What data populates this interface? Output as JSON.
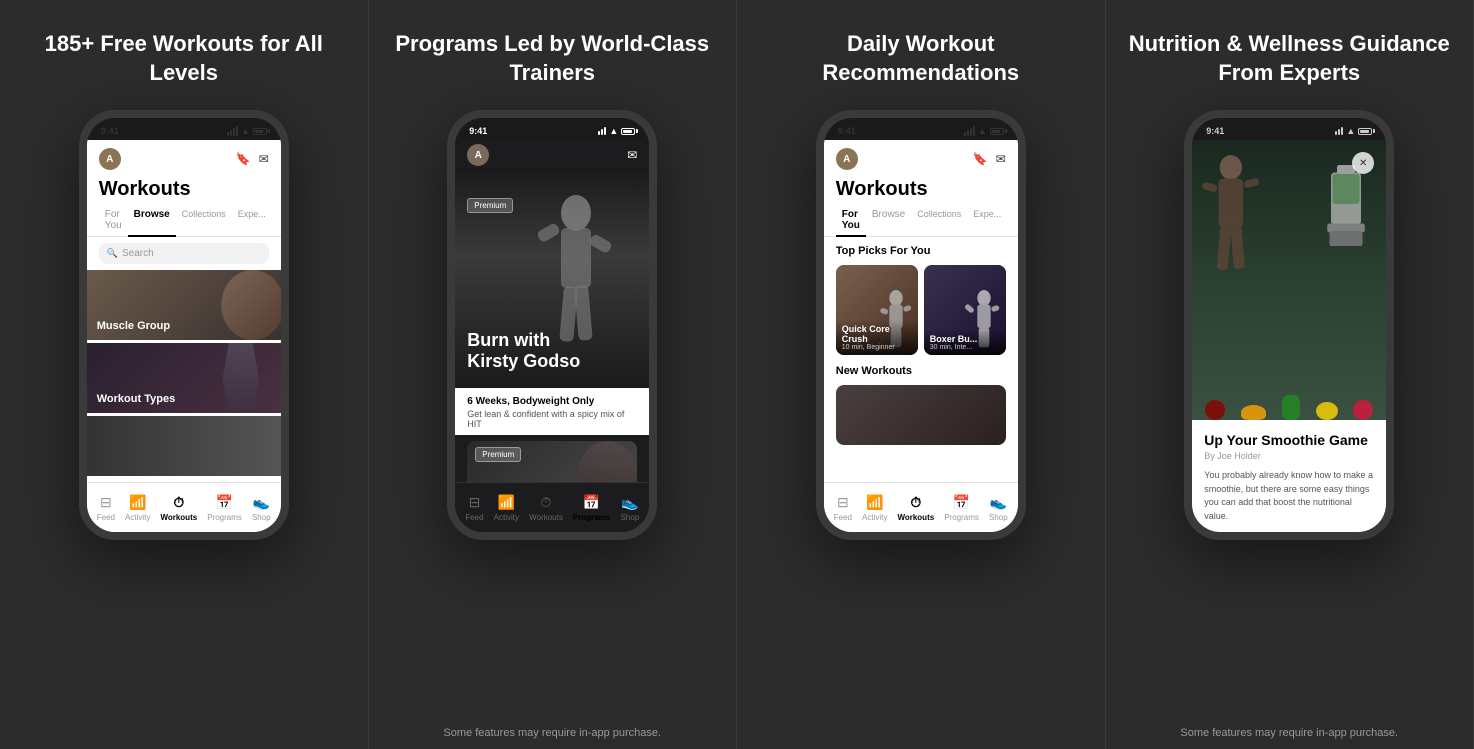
{
  "panels": [
    {
      "id": "panel-1",
      "title": "185+ Free Workouts for All Levels",
      "note": null,
      "phone": {
        "status_time": "9:41",
        "screen_bg": "light",
        "header_title": "Workouts",
        "tabs": [
          "For You",
          "Browse",
          "Collections",
          "Expe..."
        ],
        "active_tab": "Browse",
        "search_placeholder": "Search",
        "categories": [
          {
            "label": "Muscle Group",
            "bg": "muscle"
          },
          {
            "label": "Workout Types",
            "bg": "workout"
          },
          {
            "label": "",
            "bg": "explore"
          }
        ],
        "nav_items": [
          {
            "label": "Feed",
            "icon": "⊞",
            "active": false
          },
          {
            "label": "Activity",
            "icon": "📊",
            "active": false
          },
          {
            "label": "Workouts",
            "icon": "⏱",
            "active": true
          },
          {
            "label": "Programs",
            "icon": "📅",
            "active": false
          },
          {
            "label": "Shop",
            "icon": "👟",
            "active": false
          }
        ]
      }
    },
    {
      "id": "panel-2",
      "title": "Programs Led by World-Class Trainers",
      "note": "Some features may require in-app purchase.",
      "phone": {
        "status_time": "9:41",
        "screen_bg": "dark",
        "program_badge": "Premium",
        "program_title": "Burn with\nKirsty Godso",
        "program_subtitle": "6 Weeks, Bodyweight Only",
        "program_desc": "Get lean & confident with a spicy mix of HIT",
        "program_badge2": "Premium",
        "nav_items": [
          {
            "label": "Feed",
            "icon": "⊞",
            "active": false
          },
          {
            "label": "Activity",
            "icon": "📊",
            "active": false
          },
          {
            "label": "Workouts",
            "icon": "⏱",
            "active": false
          },
          {
            "label": "Programs",
            "icon": "📅",
            "active": true
          },
          {
            "label": "Shop",
            "icon": "👟",
            "active": false
          }
        ]
      }
    },
    {
      "id": "panel-3",
      "title": "Daily Workout Recommendations",
      "note": null,
      "phone": {
        "status_time": "9:41",
        "screen_bg": "light",
        "header_title": "Workouts",
        "tabs": [
          "For You",
          "Browse",
          "Collections",
          "Expe..."
        ],
        "active_tab": "For You",
        "top_picks_title": "Top Picks For You",
        "picks": [
          {
            "title": "Quick Core Crush",
            "sub": "10 min, Beginner"
          },
          {
            "title": "Boxer Bu...",
            "sub": "30 min, Inte..."
          }
        ],
        "new_workouts_title": "New Workouts",
        "nav_items": [
          {
            "label": "Feed",
            "icon": "⊞",
            "active": false
          },
          {
            "label": "Activity",
            "icon": "📊",
            "active": false
          },
          {
            "label": "Workouts",
            "icon": "⏱",
            "active": true
          },
          {
            "label": "Programs",
            "icon": "📅",
            "active": false
          },
          {
            "label": "Shop",
            "icon": "👟",
            "active": false
          }
        ]
      }
    },
    {
      "id": "panel-4",
      "title": "Nutrition & Wellness Guidance From Experts",
      "note": "Some features may require in-app purchase.",
      "phone": {
        "status_time": "9:41",
        "screen_bg": "dark",
        "close_icon": "✕",
        "article_title": "Up Your Smoothie Game",
        "article_author": "By Joe Holder",
        "article_text": "You probably already know how to make a smoothie, but there are some easy things you can add that boost the nutritional value.\n\nI have a smoothie every day–the commitment is real–and I always start with berries and dark, leafy greens. The key with"
      }
    }
  ],
  "icons": {
    "bookmark": "🔖",
    "mail": "✉",
    "search": "🔍",
    "wifi": "WiFi",
    "signal": "●●●",
    "battery": "▐"
  }
}
